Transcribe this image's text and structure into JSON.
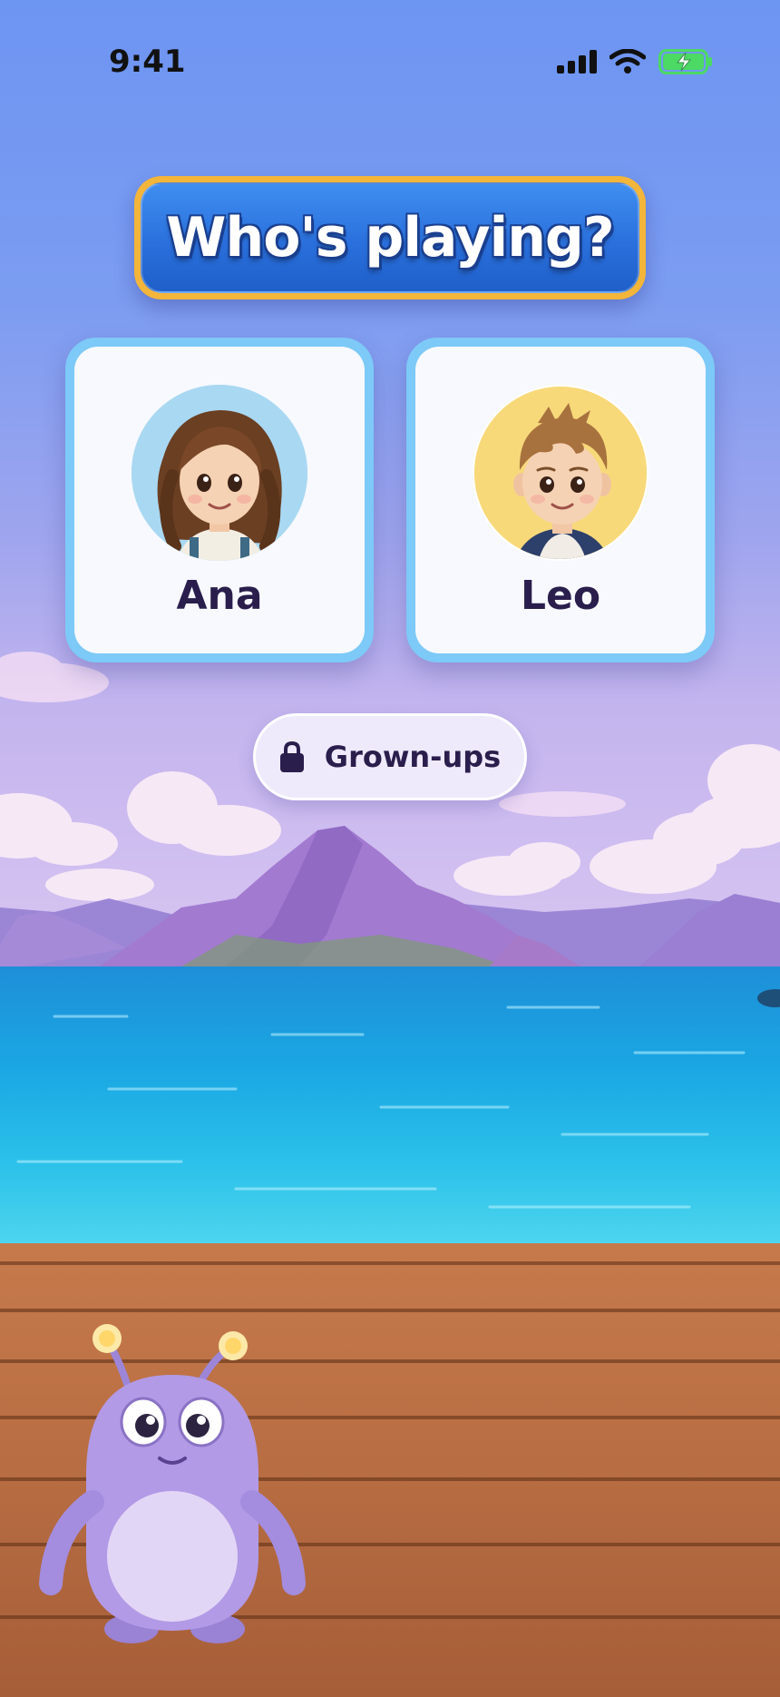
{
  "status_bar": {
    "time": "9:41",
    "icons": [
      "signal-bars-icon",
      "wifi-icon",
      "battery-charging-icon"
    ],
    "battery_color": "#4cd964"
  },
  "title": "Who's playing?",
  "profiles": [
    {
      "name": "Ana",
      "avatar": "girl-avatar",
      "avatar_bg": "#a9d8f2"
    },
    {
      "name": "Leo",
      "avatar": "boy-avatar",
      "avatar_bg": "#f8d97a"
    }
  ],
  "grown_ups": {
    "label": "Grown-ups",
    "icon": "lock-icon"
  },
  "mascot": "purple-monster-mascot",
  "colors": {
    "banner_border": "#f3b53a",
    "banner_fill": "#2a70dd",
    "card_border": "#7dc9f7",
    "text_dark": "#2a1e4d"
  }
}
